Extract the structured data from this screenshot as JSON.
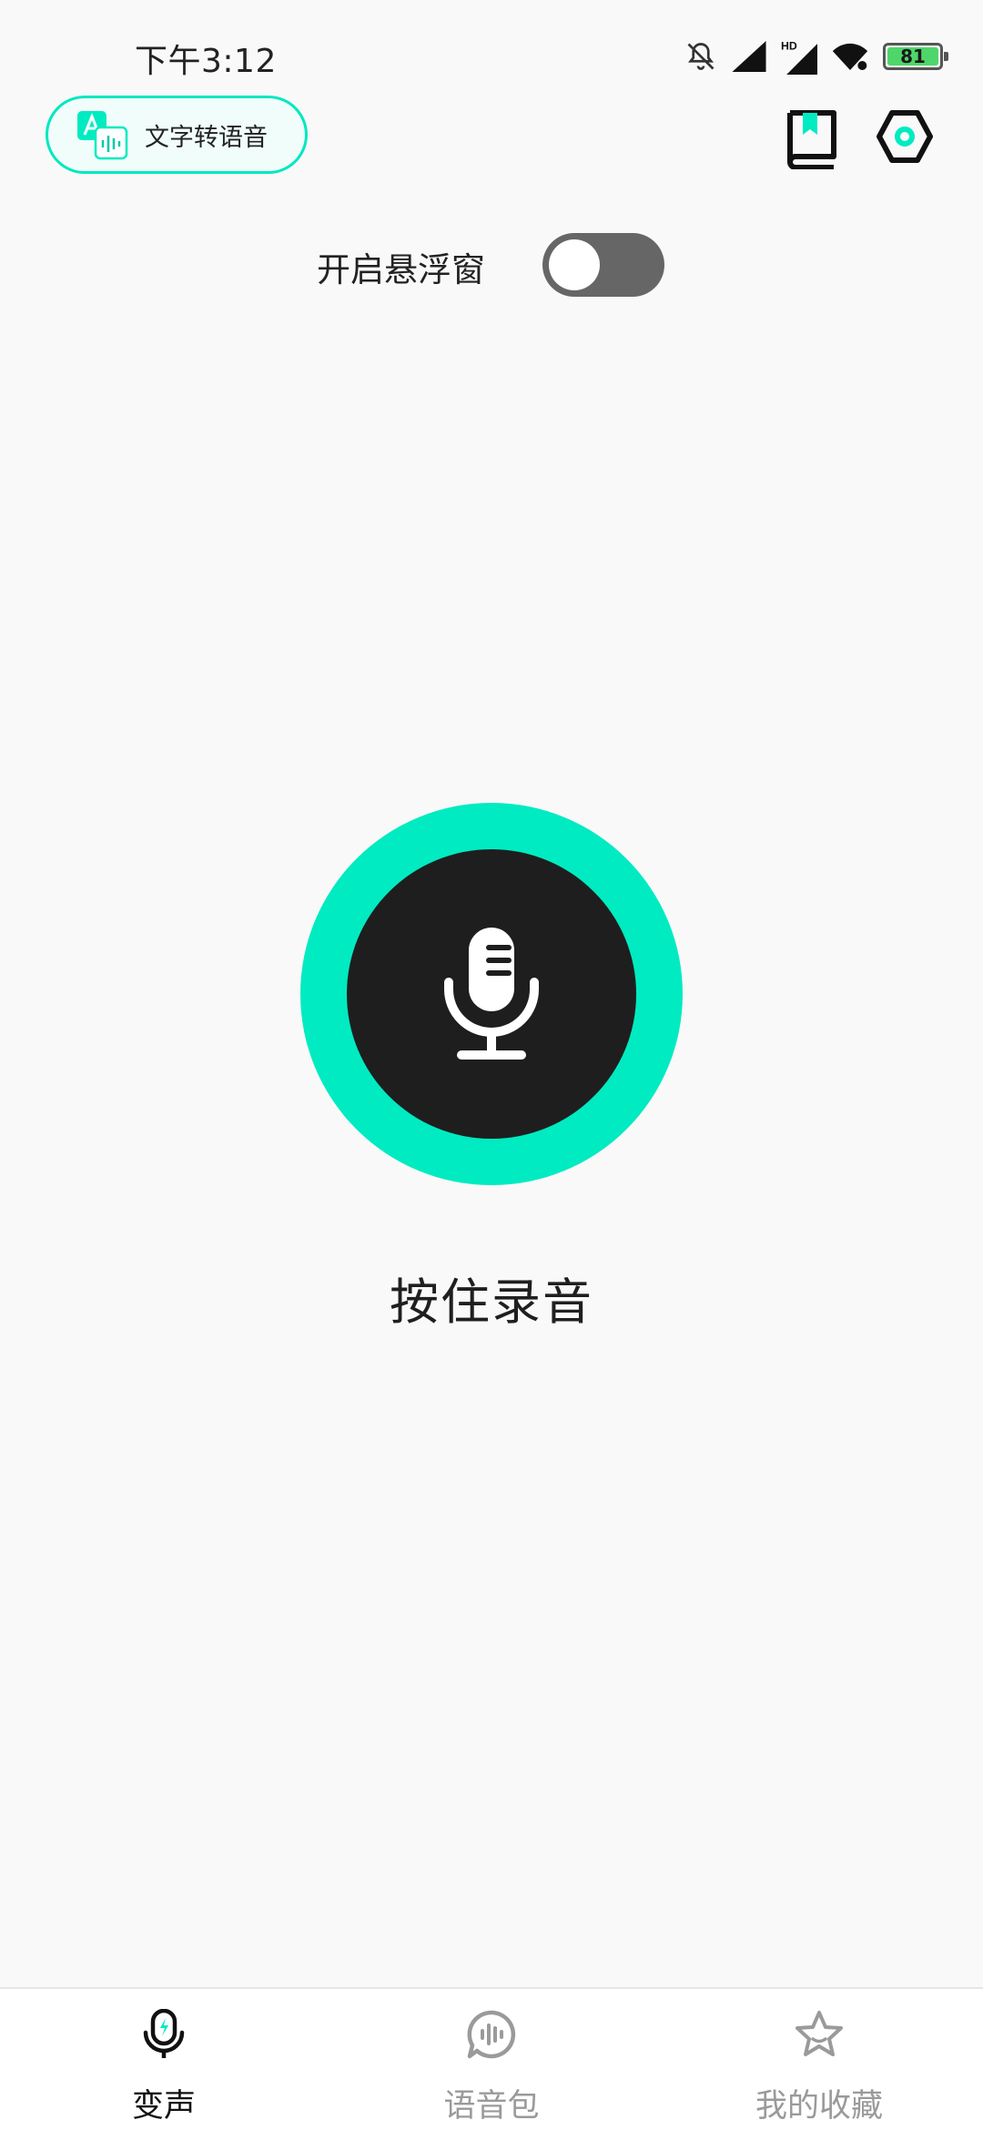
{
  "status_bar": {
    "time": "下午3:12",
    "battery": "81",
    "icons": [
      "bell-off-icon",
      "signal-icon",
      "hd-signal-icon",
      "wifi-icon",
      "battery-icon"
    ]
  },
  "header": {
    "tts_label": "文字转语音",
    "tts_icon": "text-to-speech-icon",
    "guide_icon": "book-icon",
    "settings_icon": "hexagon-settings-icon"
  },
  "floating": {
    "label": "开启悬浮窗",
    "enabled": false
  },
  "record": {
    "icon": "microphone-icon",
    "label": "按住录音"
  },
  "nav": {
    "items": [
      {
        "label": "变声",
        "icon": "voice-mic-icon",
        "active": true
      },
      {
        "label": "语音包",
        "icon": "voice-pack-icon",
        "active": false
      },
      {
        "label": "我的收藏",
        "icon": "star-icon",
        "active": false
      }
    ]
  },
  "colors": {
    "accent": "#00ebc1",
    "record_inner": "#1e1e1e",
    "toggle_off": "#666666",
    "background": "#f9f9f9"
  }
}
